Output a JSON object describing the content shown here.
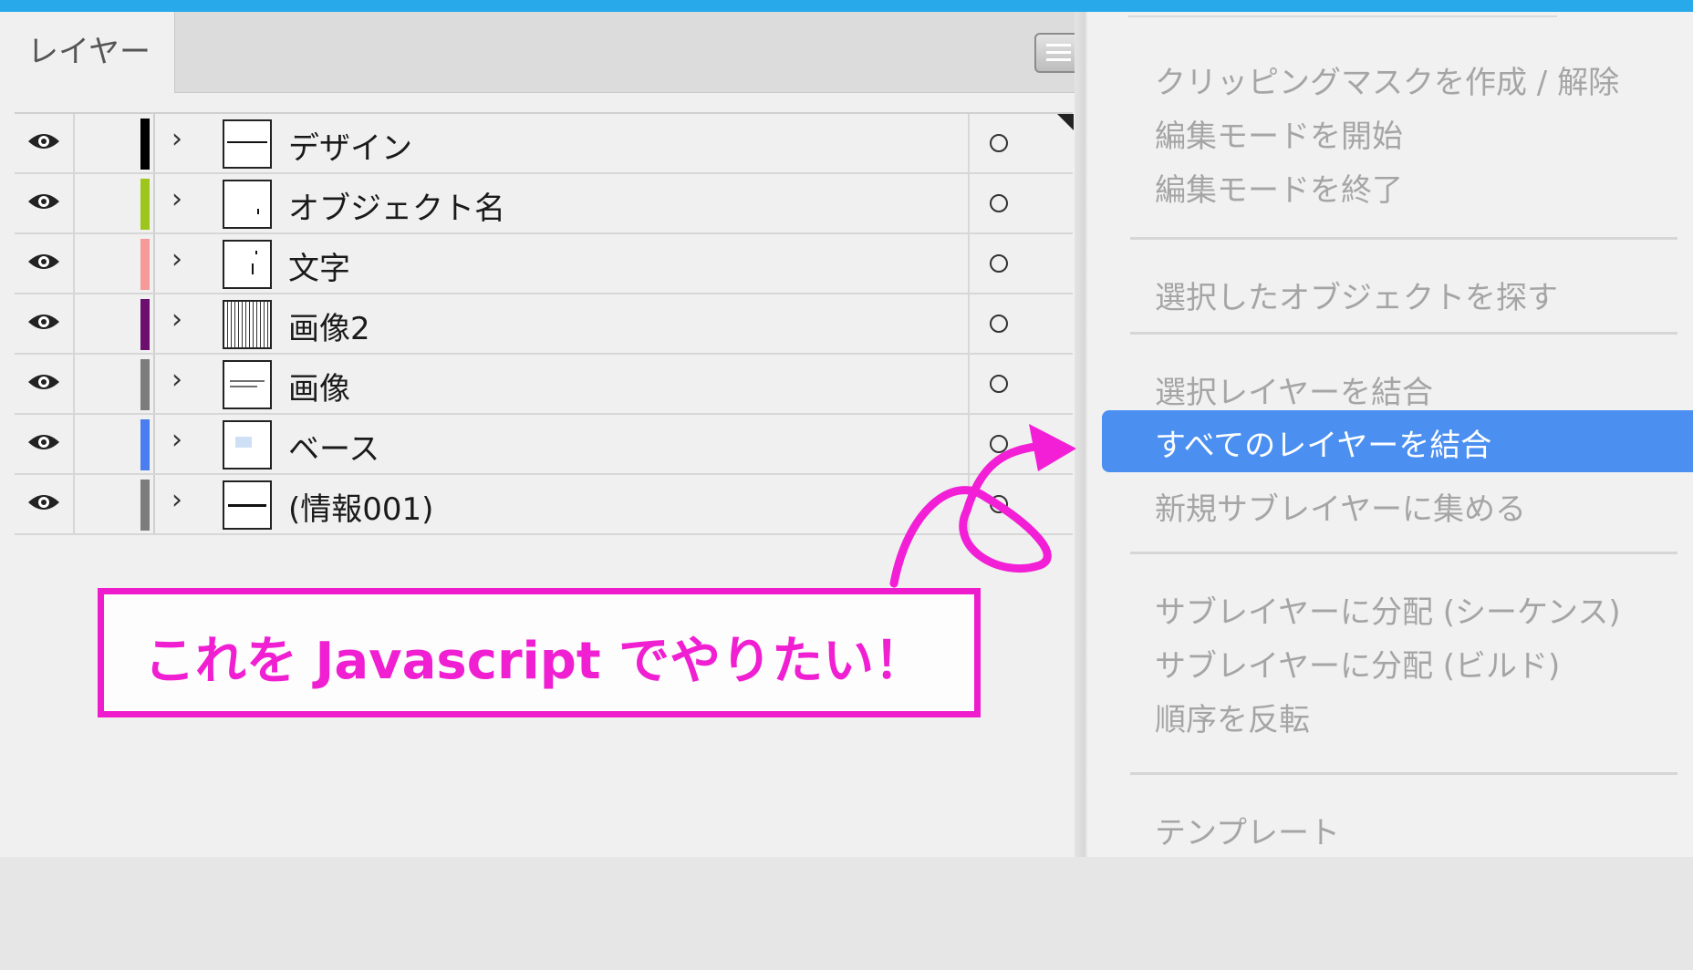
{
  "panel": {
    "tab_label": "レイヤー",
    "menu_button_icon": "hamburger-icon",
    "layers": [
      {
        "name": "デザイン",
        "color": "#000000"
      },
      {
        "name": "オブジェクト名",
        "color": "#9cc61b"
      },
      {
        "name": "文字",
        "color": "#f49a98"
      },
      {
        "name": "画像2",
        "color": "#6c0f6e"
      },
      {
        "name": "画像",
        "color": "#7c7c7c"
      },
      {
        "name": "ベース",
        "color": "#4a7ef0"
      },
      {
        "name": "(情報001)",
        "color": "#7c7c7c"
      }
    ]
  },
  "menu": {
    "items": [
      "クリッピングマスクを作成 / 解除",
      "編集モードを開始",
      "編集モードを終了",
      "選択したオブジェクトを探す",
      "選択レイヤーを結合",
      "すべてのレイヤーを結合",
      "新規サブレイヤーに集める",
      "サブレイヤーに分配 (シーケンス)",
      "サブレイヤーに分配 (ビルド)",
      "順序を反転",
      "テンプレート"
    ],
    "selected_index": 5
  },
  "annotation": {
    "text": "これを Javascript でやりたい！",
    "color": "#f01fd2"
  }
}
